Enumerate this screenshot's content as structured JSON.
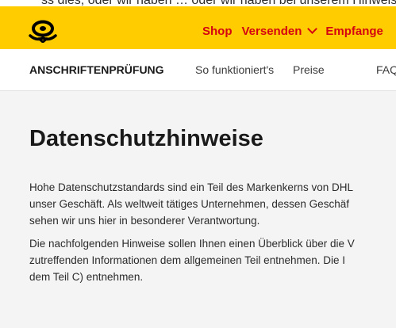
{
  "top_clip_text": "ss dies, oder wir haben … oder wir haben bei unserem Hinweis eine Adresse hinterlegt",
  "header": {
    "nav": [
      {
        "label": "Shop",
        "has_dropdown": false
      },
      {
        "label": "Versenden",
        "has_dropdown": true
      },
      {
        "label": "Empfange",
        "has_dropdown": false
      }
    ],
    "bar_color": "#ffcc00",
    "link_color": "#d40511"
  },
  "subnav": {
    "brand": "ANSCHRIFTENPRÜFUNG",
    "items": [
      "So funktioniert's",
      "Preise",
      "FAQ"
    ]
  },
  "main": {
    "title": "Datenschutzhinweise",
    "paragraph1": [
      "Hohe Datenschutzstandards sind ein Teil des Markenkerns von DHL",
      "unser Geschäft. Als weltweit tätiges Unternehmen, dessen Geschäf",
      "sehen wir uns hier in besonderer Verantwortung."
    ],
    "paragraph2": [
      "Die nachfolgenden Hinweise sollen Ihnen einen Überblick über die V",
      "zutreffenden Informationen dem allgemeinen Teil entnehmen. Die I",
      "dem Teil C) entnehmen."
    ]
  }
}
